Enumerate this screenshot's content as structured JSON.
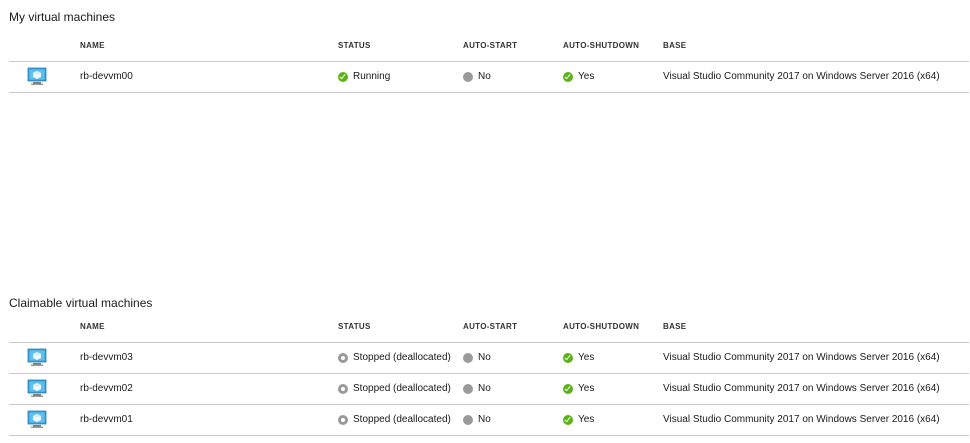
{
  "my_vms": {
    "title": "My virtual machines",
    "headers": {
      "name": "NAME",
      "status": "STATUS",
      "auto_start": "AUTO-START",
      "auto_shutdown": "AUTO-SHUTDOWN",
      "base": "BASE"
    },
    "rows": [
      {
        "name": "rb-devvm00",
        "status": "Running",
        "status_icon": "running-check-icon",
        "auto_start": "No",
        "auto_shutdown": "Yes",
        "base": "Visual Studio Community 2017 on Windows Server 2016 (x64)"
      }
    ]
  },
  "claimable_vms": {
    "title": "Claimable virtual machines",
    "headers": {
      "name": "NAME",
      "status": "STATUS",
      "auto_start": "AUTO-START",
      "auto_shutdown": "AUTO-SHUTDOWN",
      "base": "BASE"
    },
    "rows": [
      {
        "name": "rb-devvm03",
        "status": "Stopped (deallocated)",
        "status_icon": "stopped-icon",
        "auto_start": "No",
        "auto_shutdown": "Yes",
        "base": "Visual Studio Community 2017 on Windows Server 2016 (x64)"
      },
      {
        "name": "rb-devvm02",
        "status": "Stopped (deallocated)",
        "status_icon": "stopped-icon",
        "auto_start": "No",
        "auto_shutdown": "Yes",
        "base": "Visual Studio Community 2017 on Windows Server 2016 (x64)"
      },
      {
        "name": "rb-devvm01",
        "status": "Stopped (deallocated)",
        "status_icon": "stopped-icon",
        "auto_start": "No",
        "auto_shutdown": "Yes",
        "base": "Visual Studio Community 2017 on Windows Server 2016 (x64)"
      }
    ]
  },
  "colors": {
    "ok_green": "#5bb318",
    "neutral_gray": "#9a9a9a",
    "divider": "#c8c8c8",
    "vm_icon_blue": "#3aa0d8"
  }
}
